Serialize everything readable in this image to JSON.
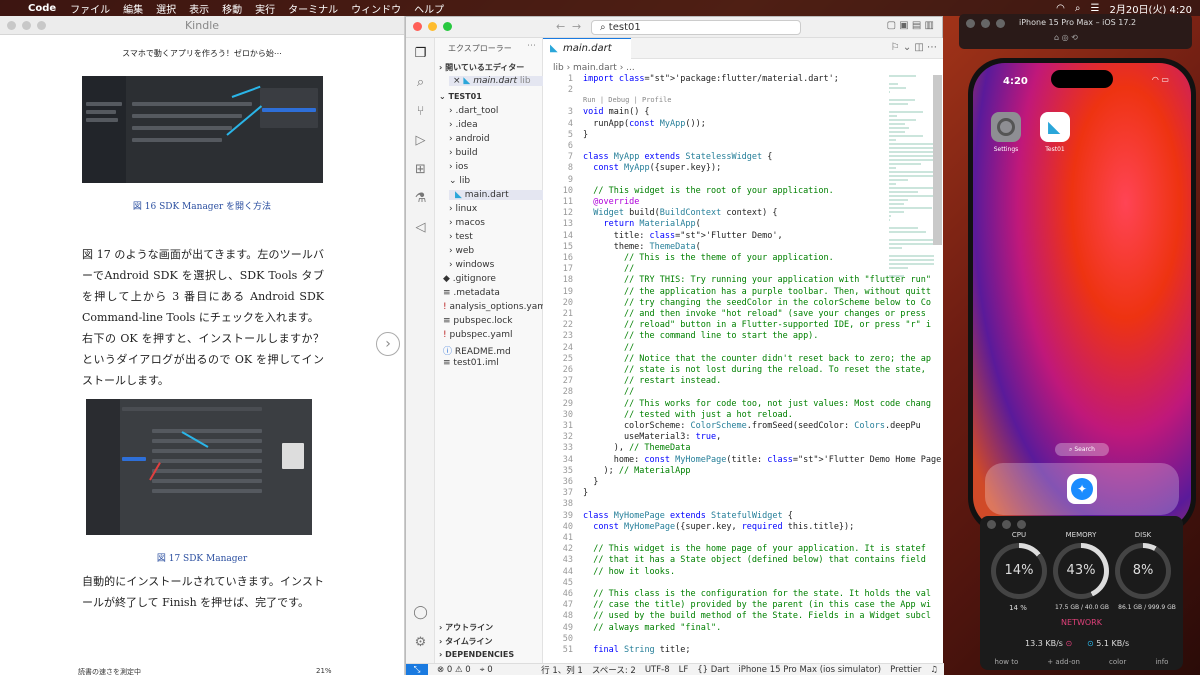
{
  "menubar": {
    "app": "Code",
    "items": [
      "ファイル",
      "編集",
      "選択",
      "表示",
      "移動",
      "実行",
      "ターミナル",
      "ウィンドウ",
      "ヘルプ"
    ],
    "clock": "2月20日(火) 4:20"
  },
  "kindle": {
    "window_title": "Kindle",
    "book_title": "スマホで動くアプリを作ろう！ゼロから始⋯",
    "fig16_caption": "図 16 SDK Manager を開く方法",
    "para1": "図 17 のような画面が出てきます。左のツールバーでAndroid SDK を選択し、SDK Tools タブを押して上から 3 番目にある Android SDK Command-line Tools にチェックを入れます。",
    "para2": "右下の OK を押すと、インストールしますか？というダイアログが出るので OK を押してインストールします。",
    "fig17_caption": "図 17 SDK Manager",
    "para3": "自動的にインストールされていきます。インストールが終了して Finish を押せば、完了です。",
    "footer_left": "読書の速さを測定中",
    "footer_right": "21%",
    "next_icon": "chevron-right"
  },
  "vscode": {
    "search": "test01",
    "explorer_title": "エクスプローラー",
    "open_editors": "開いているエディター",
    "open_file": "main.dart",
    "open_file_dir": "lib",
    "project": "TEST01",
    "tree": [
      ".dart_tool",
      ".idea",
      "android",
      "build",
      "ios",
      "lib",
      "main.dart",
      "linux",
      "macos",
      "test",
      "web",
      "windows",
      ".gitignore",
      ".metadata",
      "analysis_options.yaml",
      "pubspec.lock",
      "pubspec.yaml",
      "README.md",
      "test01.iml"
    ],
    "outline": "アウトライン",
    "timeline": "タイムライン",
    "deps": "DEPENDENCIES",
    "tab": "main.dart",
    "breadcrumb": "lib  ›  main.dart  ›  ...",
    "codelens": "Run | Debug | Profile",
    "status": {
      "errors": "0",
      "warnings": "0",
      "ports": "0",
      "pos": "行 1、列 1",
      "spaces": "スペース: 2",
      "enc": "UTF-8",
      "eol": "LF",
      "lang": "{} Dart",
      "device": "iPhone 15 Pro Max (ios simulator)",
      "prettier": "Prettier"
    }
  },
  "code": [
    {
      "n": "1",
      "t": "import 'package:flutter/material.dart';"
    },
    {
      "n": "2",
      "t": ""
    },
    {
      "n": "3",
      "t": "void main() {"
    },
    {
      "n": "4",
      "t": "  runApp(const MyApp());"
    },
    {
      "n": "5",
      "t": "}"
    },
    {
      "n": "6",
      "t": ""
    },
    {
      "n": "7",
      "t": "class MyApp extends StatelessWidget {"
    },
    {
      "n": "8",
      "t": "  const MyApp({super.key});"
    },
    {
      "n": "9",
      "t": ""
    },
    {
      "n": "10",
      "t": "  // This widget is the root of your application."
    },
    {
      "n": "11",
      "t": "  @override"
    },
    {
      "n": "12",
      "t": "  Widget build(BuildContext context) {"
    },
    {
      "n": "13",
      "t": "    return MaterialApp("
    },
    {
      "n": "14",
      "t": "      title: 'Flutter Demo',"
    },
    {
      "n": "15",
      "t": "      theme: ThemeData("
    },
    {
      "n": "16",
      "t": "        // This is the theme of your application."
    },
    {
      "n": "17",
      "t": "        //"
    },
    {
      "n": "18",
      "t": "        // TRY THIS: Try running your application with \"flutter run\""
    },
    {
      "n": "19",
      "t": "        // the application has a purple toolbar. Then, without quitt"
    },
    {
      "n": "20",
      "t": "        // try changing the seedColor in the colorScheme below to Co"
    },
    {
      "n": "21",
      "t": "        // and then invoke \"hot reload\" (save your changes or press"
    },
    {
      "n": "22",
      "t": "        // reload\" button in a Flutter-supported IDE, or press \"r\" i"
    },
    {
      "n": "23",
      "t": "        // the command line to start the app)."
    },
    {
      "n": "24",
      "t": "        //"
    },
    {
      "n": "25",
      "t": "        // Notice that the counter didn't reset back to zero; the ap"
    },
    {
      "n": "26",
      "t": "        // state is not lost during the reload. To reset the state,"
    },
    {
      "n": "27",
      "t": "        // restart instead."
    },
    {
      "n": "28",
      "t": "        //"
    },
    {
      "n": "29",
      "t": "        // This works for code too, not just values: Most code chang"
    },
    {
      "n": "30",
      "t": "        // tested with just a hot reload."
    },
    {
      "n": "31",
      "t": "        colorScheme: ColorScheme.fromSeed(seedColor: Colors.deepPu"
    },
    {
      "n": "32",
      "t": "        useMaterial3: true,"
    },
    {
      "n": "33",
      "t": "      ), // ThemeData"
    },
    {
      "n": "34",
      "t": "      home: const MyHomePage(title: 'Flutter Demo Home Page'),"
    },
    {
      "n": "35",
      "t": "    ); // MaterialApp"
    },
    {
      "n": "36",
      "t": "  }"
    },
    {
      "n": "37",
      "t": "}"
    },
    {
      "n": "38",
      "t": ""
    },
    {
      "n": "39",
      "t": "class MyHomePage extends StatefulWidget {"
    },
    {
      "n": "40",
      "t": "  const MyHomePage({super.key, required this.title});"
    },
    {
      "n": "41",
      "t": ""
    },
    {
      "n": "42",
      "t": "  // This widget is the home page of your application. It is statef"
    },
    {
      "n": "43",
      "t": "  // that it has a State object (defined below) that contains field"
    },
    {
      "n": "44",
      "t": "  // how it looks."
    },
    {
      "n": "45",
      "t": ""
    },
    {
      "n": "46",
      "t": "  // This class is the configuration for the state. It holds the val"
    },
    {
      "n": "47",
      "t": "  // case the title) provided by the parent (in this case the App wi"
    },
    {
      "n": "48",
      "t": "  // used by the build method of the State. Fields in a Widget subcl"
    },
    {
      "n": "49",
      "t": "  // always marked \"final\"."
    },
    {
      "n": "50",
      "t": ""
    },
    {
      "n": "51",
      "t": "  final String title;"
    }
  ],
  "simulator": {
    "title": "iPhone 15 Pro Max – iOS 17.2",
    "time": "4:20",
    "apps": [
      {
        "label": "Settings",
        "color": "#8e8e93"
      },
      {
        "label": "Test01",
        "color": "#ffffff"
      }
    ],
    "search": "Search"
  },
  "monitor": {
    "cpu": {
      "label": "CPU",
      "pct": "14%",
      "sub": "14 %",
      "value": 0.14
    },
    "memory": {
      "label": "MEMORY",
      "pct": "43%",
      "sub": "17.5 GB / 40.0 GB",
      "value": 0.43
    },
    "disk": {
      "label": "DISK",
      "pct": "8%",
      "sub": "86.1 GB / 999.9 GB",
      "value": 0.08
    },
    "network": "NETWORK",
    "down": "13.3 KB/s",
    "up": "5.1 KB/s",
    "tabs": [
      "how to",
      "+ add-on",
      "color",
      "info"
    ]
  }
}
